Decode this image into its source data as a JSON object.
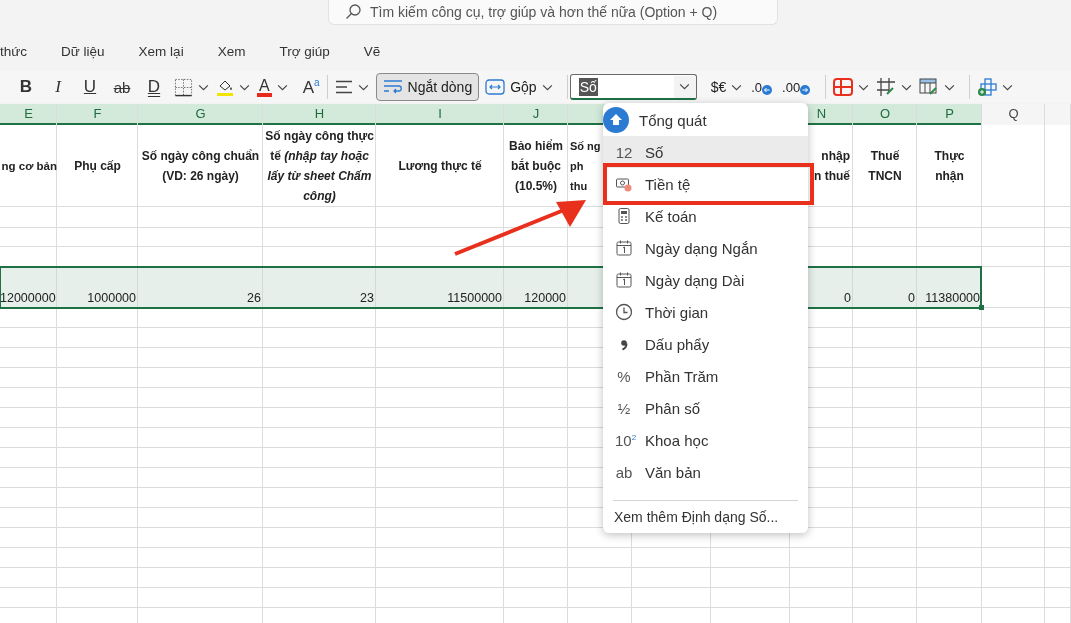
{
  "search": {
    "placeholder": "Tìm kiếm công cụ, trợ giúp và hơn thế nữa (Option + Q)"
  },
  "menu_tabs": [
    "thức",
    "Dữ liệu",
    "Xem lại",
    "Xem",
    "Trợ giúp",
    "Vẽ"
  ],
  "toolbar": {
    "text_buttons": [
      {
        "kind": "bold",
        "label": "B"
      },
      {
        "kind": "italic",
        "label": "I"
      },
      {
        "kind": "underline",
        "label": "U"
      },
      {
        "kind": "strike",
        "label": "ab"
      },
      {
        "kind": "double-underline",
        "label": "D"
      }
    ],
    "font_color_label": "A",
    "grow_font_label": "A$^{a}$",
    "wrap_text": {
      "label": "Ngắt dòng",
      "on": true
    },
    "merge_label": "Gộp",
    "number_format": {
      "value": "Số"
    },
    "currency_label": "$€",
    "decrease_decimal_label": ".0",
    "increase_decimal_label": ".00"
  },
  "sheet": {
    "columns": [
      {
        "letter": "E",
        "header": "ng cơ bản",
        "value": "12000000"
      },
      {
        "letter": "F",
        "header": "Phụ cấp",
        "value": "1000000"
      },
      {
        "letter": "G",
        "header": "Số ngày công chuẩn (VD: 26 ngày)",
        "value": "26"
      },
      {
        "letter": "H",
        "header": "Số ngày công thực tế *(nhập tay hoặc lấy từ sheet Chấm công)*",
        "value": "23"
      },
      {
        "letter": "I",
        "header": "Lương thực tế",
        "value": "11500000"
      },
      {
        "letter": "J",
        "header": "Bảo hiểm bắt buộc (10.5%)",
        "value": "120000"
      },
      {
        "header": "Số ng\nph\nthu"
      },
      {
        "letter": "N",
        "header": "nhập\nn thuế",
        "value": "0"
      },
      {
        "letter": "O",
        "header": "Thuế TNCN",
        "value": "0"
      },
      {
        "letter": "P",
        "header": "Thực nhận",
        "value": "11380000"
      },
      {
        "letter": "Q"
      }
    ]
  },
  "format_menu": {
    "items": [
      {
        "kind": "general",
        "label": "Tổng quát",
        "selected": false,
        "annotated": false
      },
      {
        "kind": "number",
        "glyph": "12",
        "label": "Số",
        "selected": true,
        "annotated": false
      },
      {
        "kind": "currency",
        "label": "Tiền tệ",
        "selected": false,
        "annotated": true
      },
      {
        "kind": "accounting",
        "label": "Kế toán",
        "selected": false,
        "annotated": false
      },
      {
        "kind": "date-short",
        "label": "Ngày dạng Ngắn",
        "selected": false,
        "annotated": false
      },
      {
        "kind": "date-long",
        "label": "Ngày dạng Dài",
        "selected": false,
        "annotated": false
      },
      {
        "kind": "time",
        "label": "Thời gian",
        "selected": false,
        "annotated": false
      },
      {
        "kind": "comma",
        "label": "Dấu phẩy",
        "selected": false,
        "annotated": false
      },
      {
        "kind": "percent",
        "glyph": "%",
        "label": "Phần Trăm",
        "selected": false,
        "annotated": false
      },
      {
        "kind": "fraction",
        "glyph": "½",
        "label": "Phân số",
        "selected": false,
        "annotated": false
      },
      {
        "kind": "scientific",
        "glyph": "10$^{2}$",
        "label": "Khoa học",
        "selected": false,
        "annotated": false
      },
      {
        "kind": "text",
        "glyph": "ab",
        "label": "Văn bản",
        "selected": false,
        "annotated": false
      }
    ],
    "footer": "Xem thêm Định dạng Số..."
  }
}
